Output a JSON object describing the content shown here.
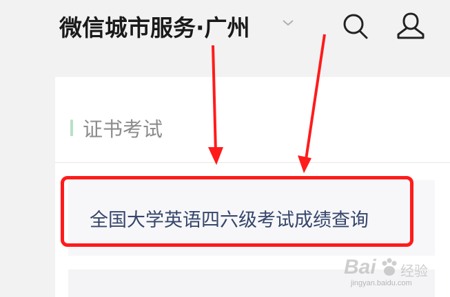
{
  "header": {
    "title": "微信城市服务·广州",
    "city_dropdown_icon": "chevron-down-icon",
    "search_icon": "search-icon",
    "user_icon": "user-icon"
  },
  "section": {
    "title": "证书考试",
    "accent_color": "#b9e0c6",
    "items": [
      {
        "label": "全国大学英语四六级考试成绩查询"
      }
    ]
  },
  "annotation": {
    "highlight_color": "#ff1b1b"
  },
  "watermark": {
    "brand": "Bai",
    "brand_cn": "经验",
    "url": "jingyan.baidu.com"
  }
}
